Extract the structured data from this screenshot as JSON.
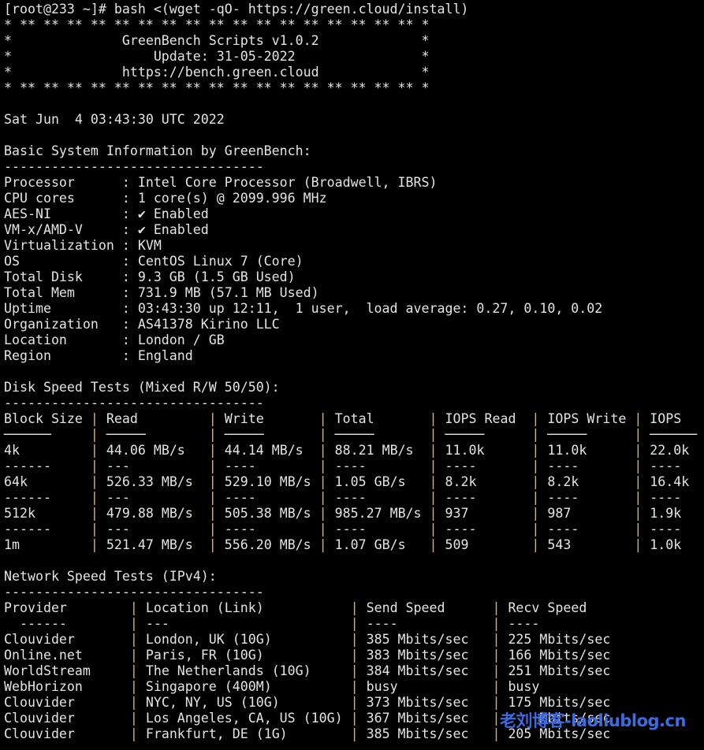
{
  "colors": {
    "background": "#000000",
    "text": "#e4e4e4",
    "pipe": "#e0b070",
    "watermark": "#3d6be0"
  },
  "prompt": "[root@233 ~]# bash <(wget -qO- https://green.cloud/install)",
  "banner": {
    "title": "GreenBench Scripts v1.0.2",
    "update": "Update: 31-05-2022",
    "url": "https://bench.green.cloud"
  },
  "date": "Sat Jun  4 03:43:30 UTC 2022",
  "system": {
    "heading": "Basic System Information by GreenBench:",
    "items": [
      {
        "label": "Processor",
        "value": "Intel Core Processor (Broadwell, IBRS)"
      },
      {
        "label": "CPU cores",
        "value": "1 core(s) @ 2099.996 MHz"
      },
      {
        "label": "AES-NI",
        "value": "✔ Enabled"
      },
      {
        "label": "VM-x/AMD-V",
        "value": "✔ Enabled"
      },
      {
        "label": "Virtualization",
        "value": "KVM"
      },
      {
        "label": "OS",
        "value": "CentOS Linux 7 (Core)"
      },
      {
        "label": "Total Disk",
        "value": "9.3 GB (1.5 GB Used)"
      },
      {
        "label": "Total Mem",
        "value": "731.9 MB (57.1 MB Used)"
      },
      {
        "label": "Uptime",
        "value": "03:43:30 up 12:11,  1 user,  load average: 0.27, 0.10, 0.02"
      },
      {
        "label": "Organization",
        "value": "AS41378 Kirino LLC"
      },
      {
        "label": "Location",
        "value": "London / GB"
      },
      {
        "label": "Region",
        "value": "England"
      }
    ]
  },
  "disk": {
    "heading": "Disk Speed Tests (Mixed R/W 50/50):",
    "columns": [
      "Block Size",
      "Read",
      "Write",
      "Total",
      "IOPS Read",
      "IOPS Write",
      "IOPS"
    ],
    "rows": [
      [
        "4k",
        "44.06 MB/s",
        "44.14 MB/s",
        "88.21 MB/s",
        "11.0k",
        "11.0k",
        "22.0k"
      ],
      [
        "64k",
        "526.33 MB/s",
        "529.10 MB/s",
        "1.05 GB/s",
        "8.2k",
        "8.2k",
        "16.4k"
      ],
      [
        "512k",
        "479.88 MB/s",
        "505.38 MB/s",
        "985.27 MB/s",
        "937",
        "987",
        "1.9k"
      ],
      [
        "1m",
        "521.47 MB/s",
        "556.20 MB/s",
        "1.07 GB/s",
        "509",
        "543",
        "1.0k"
      ]
    ]
  },
  "network": {
    "heading": "Network Speed Tests (IPv4):",
    "columns": [
      "Provider",
      "Location (Link)",
      "Send Speed",
      "Recv Speed"
    ],
    "rows": [
      [
        "Clouvider",
        "London, UK (10G)",
        "385 Mbits/sec",
        "225 Mbits/sec"
      ],
      [
        "Online.net",
        "Paris, FR (10G)",
        "383 Mbits/sec",
        "166 Mbits/sec"
      ],
      [
        "WorldStream",
        "The Netherlands (10G)",
        "384 Mbits/sec",
        "251 Mbits/sec"
      ],
      [
        "WebHorizon",
        "Singapore (400M)",
        "busy",
        "busy"
      ],
      [
        "Clouvider",
        "NYC, NY, US (10G)",
        "373 Mbits/sec",
        "175 Mbits/sec"
      ],
      [
        "Clouvider",
        "Los Angeles, CA, US (10G)",
        "367 Mbits/sec",
        "    Mbits/sec"
      ],
      [
        "Clouvider",
        "Frankfurt, DE (1G)",
        "385 Mbits/sec",
        "205 Mbits/sec"
      ]
    ]
  },
  "watermark": "老刘博客-laoliublog.cn"
}
